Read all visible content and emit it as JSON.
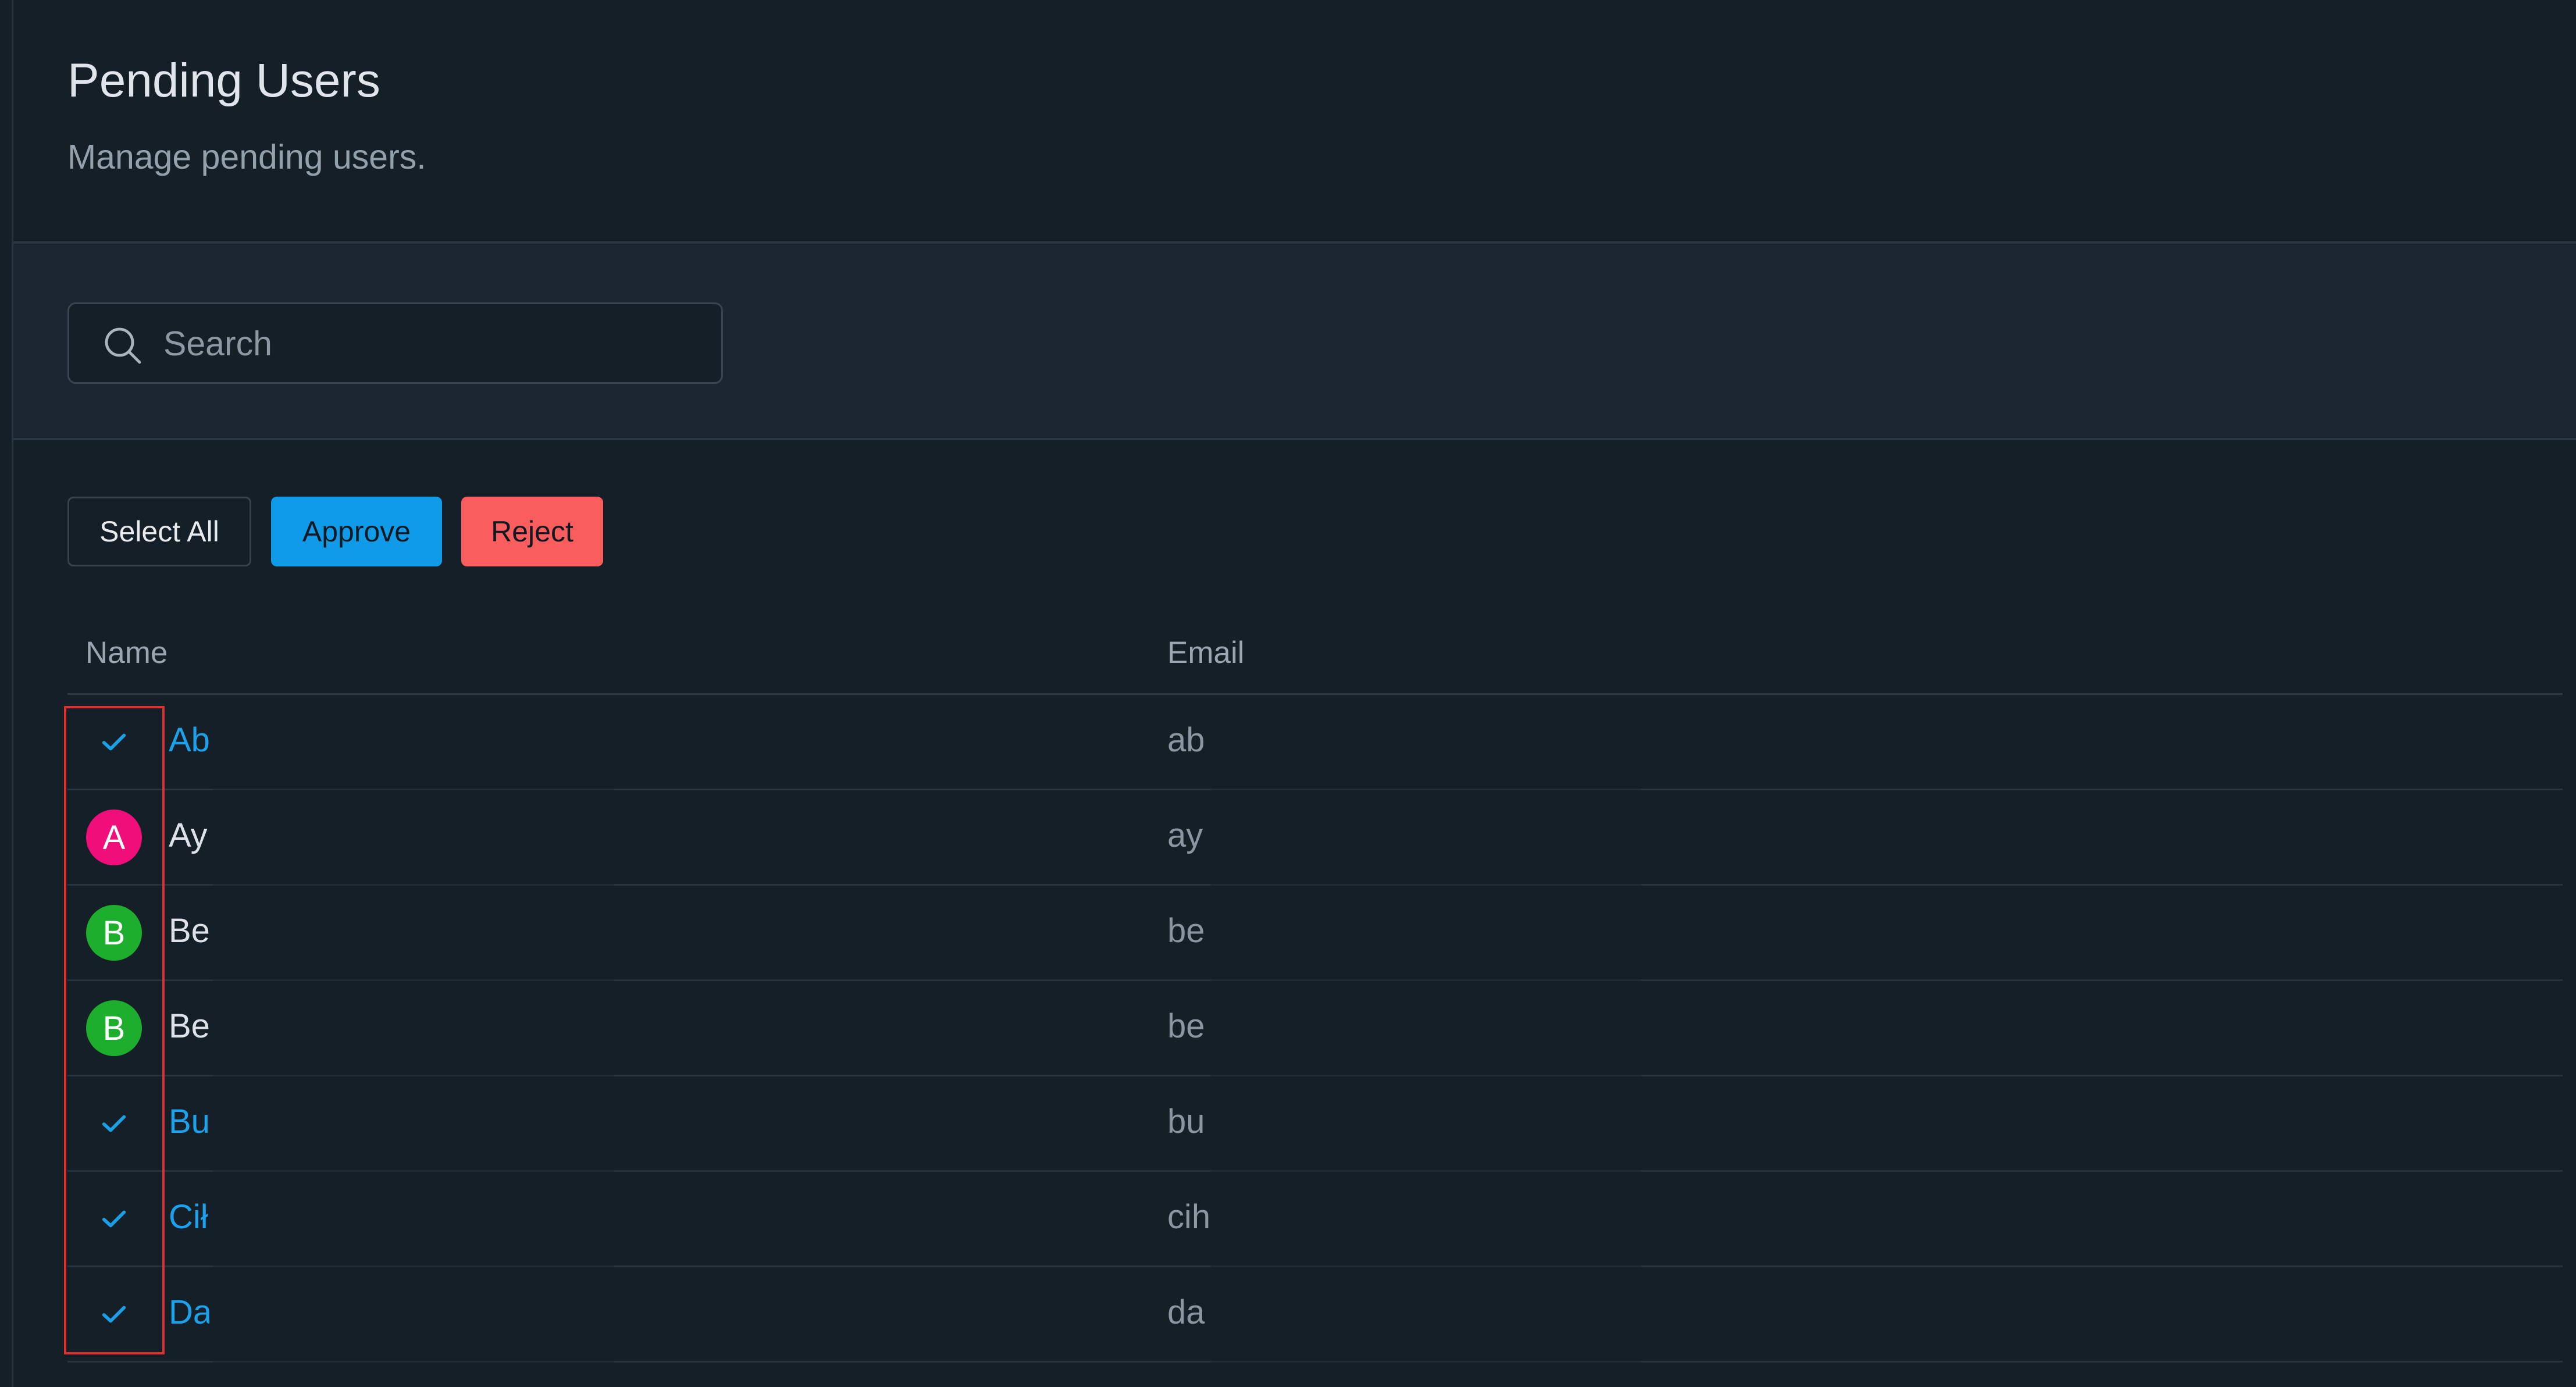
{
  "header": {
    "title": "Pending Users",
    "subtitle": "Manage pending users."
  },
  "search": {
    "placeholder": "Search",
    "icon": "search-icon"
  },
  "actions": {
    "select_all_label": "Select All",
    "approve_label": "Approve",
    "reject_label": "Reject",
    "approve_color": "#109be8",
    "reject_color": "#fa5d5d"
  },
  "table": {
    "columns": [
      "Name",
      "Email"
    ],
    "rows": [
      {
        "selected": true,
        "avatar_letter": "",
        "avatar_color": "",
        "name": "Ab",
        "email": "ab"
      },
      {
        "selected": false,
        "avatar_letter": "A",
        "avatar_color": "#f00f7a",
        "name": "Ay",
        "email": "ay"
      },
      {
        "selected": false,
        "avatar_letter": "B",
        "avatar_color": "#1cae2c",
        "name": "Be",
        "email": "be"
      },
      {
        "selected": false,
        "avatar_letter": "B",
        "avatar_color": "#1cae2c",
        "name": "Be",
        "email": "be"
      },
      {
        "selected": true,
        "avatar_letter": "",
        "avatar_color": "",
        "name": "Bu",
        "email": "bu"
      },
      {
        "selected": true,
        "avatar_letter": "",
        "avatar_color": "",
        "name": "Cił",
        "email": "cih"
      },
      {
        "selected": true,
        "avatar_letter": "",
        "avatar_color": "",
        "name": "Da",
        "email": "da"
      }
    ]
  },
  "colors": {
    "background": "#151f28",
    "accent": "#1ca1ec",
    "highlight": "#e02f2f"
  }
}
